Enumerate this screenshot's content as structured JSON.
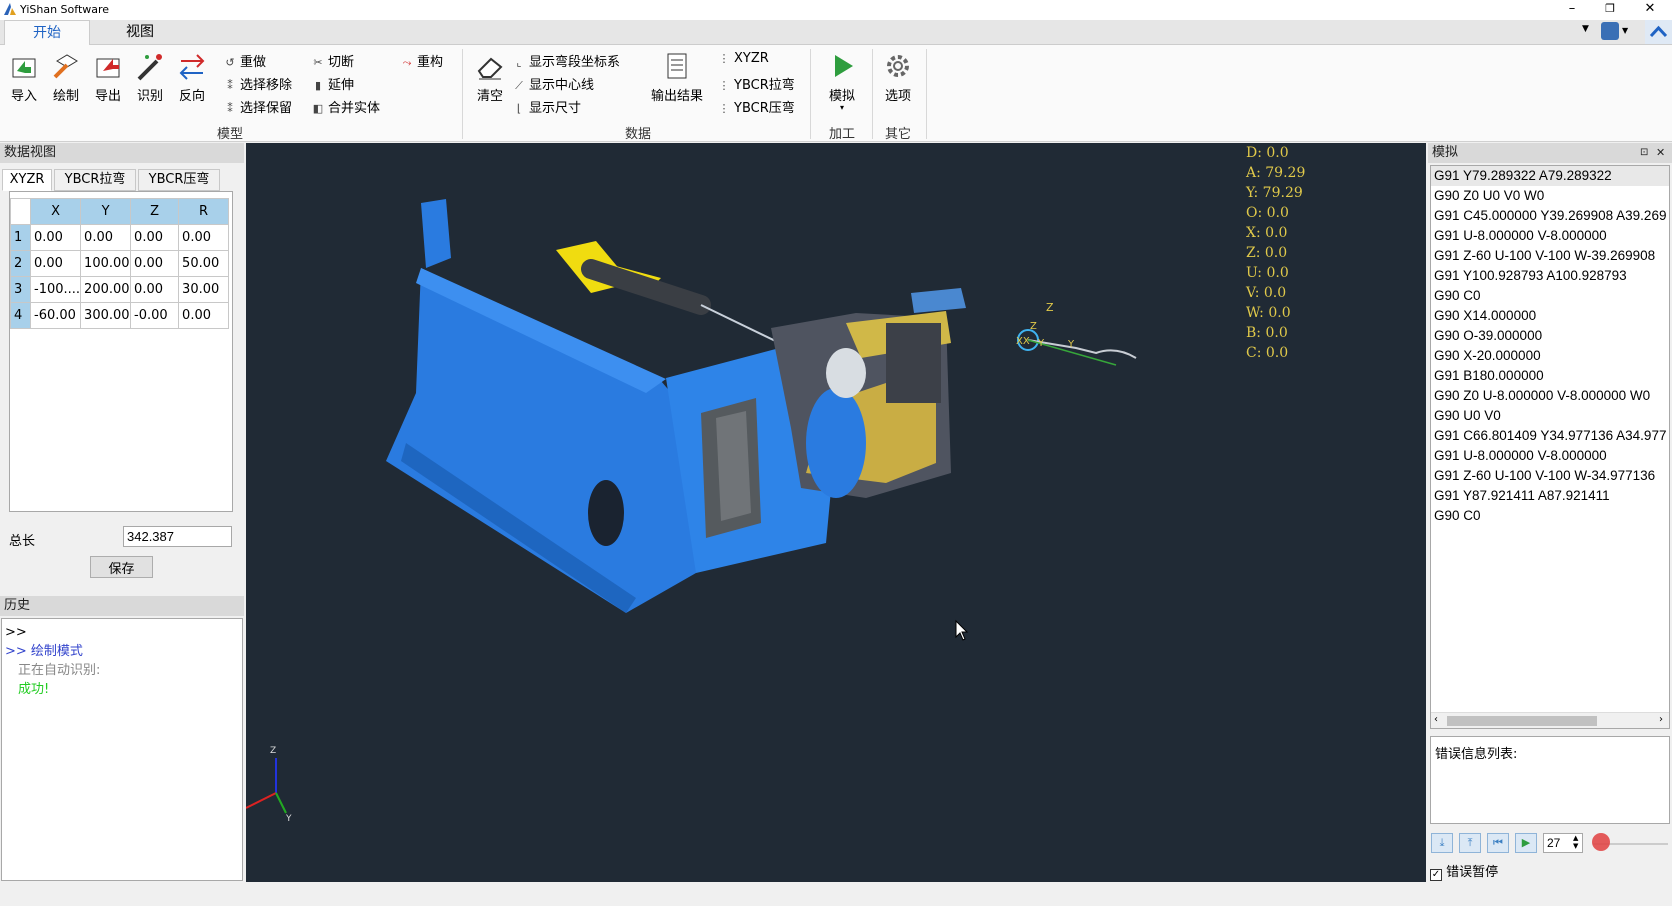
{
  "app": {
    "title": "YiShan Software"
  },
  "window_controls": {
    "minimize": "–",
    "restore": "❐",
    "close": "✕"
  },
  "tabs": [
    {
      "label": "开始",
      "active": true
    },
    {
      "label": "视图",
      "active": false
    }
  ],
  "ribbon": {
    "model_group": {
      "label": "模型",
      "big_buttons": [
        "导入",
        "绘制",
        "导出",
        "识别",
        "反向"
      ],
      "col1": [
        "重做",
        "选择移除",
        "选择保留"
      ],
      "col2": [
        "切断",
        "延伸",
        "合并实体"
      ],
      "col3": [
        "重构"
      ]
    },
    "data_group": {
      "label": "数据",
      "clear": "清空",
      "col1": [
        "显示弯段坐标系",
        "显示中心线",
        "显示尺寸"
      ],
      "output": "输出结果",
      "col2": [
        "XYZR",
        "YBCR拉弯",
        "YBCR压弯"
      ]
    },
    "process_group": {
      "label": "加工",
      "simulate": "模拟"
    },
    "other_group": {
      "label": "其它",
      "options": "选项"
    }
  },
  "data_view": {
    "title": "数据视图",
    "subtabs": [
      "XYZR",
      "YBCR拉弯",
      "YBCR压弯"
    ],
    "columns": [
      "X",
      "Y",
      "Z",
      "R"
    ],
    "rows": [
      {
        "n": "1",
        "cells": [
          "0.00",
          "0.00",
          "0.00",
          "0.00"
        ]
      },
      {
        "n": "2",
        "cells": [
          "0.00",
          "100.00",
          "0.00",
          "50.00"
        ]
      },
      {
        "n": "3",
        "cells": [
          "-100....",
          "200.00",
          "0.00",
          "30.00"
        ]
      },
      {
        "n": "4",
        "cells": [
          "-60.00",
          "300.00",
          "-0.00",
          "0.00"
        ]
      }
    ],
    "total_length_label": "总长",
    "total_length_value": "342.387",
    "save_label": "保存"
  },
  "history": {
    "title": "历史",
    "lines": [
      ">>",
      ">> 绘制模式",
      "正在自动识别:",
      "成功!"
    ]
  },
  "viewport_readout": [
    "D: 0.0",
    "A: 79.29",
    "Y: 79.29",
    "O: 0.0",
    "X: 0.0",
    "Z: 0.0",
    "U: 0.0",
    "V: 0.0",
    "W: 0.0",
    "B: 0.0",
    "C: 0.0"
  ],
  "axis_labels": {
    "z": "Z",
    "x": "X",
    "y": "Y"
  },
  "simulation": {
    "title": "模拟",
    "pin_icon": "⊡",
    "close_icon": "✕",
    "code_lines": [
      "G91 Y79.289322 A79.289322",
      "G90 Z0 U0 V0 W0",
      "G91 C45.000000 Y39.269908 A39.269",
      "G91 U-8.000000 V-8.000000",
      "G91 Z-60 U-100 V-100 W-39.269908",
      "G91 Y100.928793 A100.928793",
      "G90 C0",
      "G90 X14.000000",
      "G90 O-39.000000",
      "G90 X-20.000000",
      "G91 B180.000000",
      "G90 Z0 U-8.000000 V-8.000000 W0",
      "G90 U0 V0",
      "G91 C66.801409 Y34.977136 A34.977",
      "G91 U-8.000000 V-8.000000",
      "G91 Z-60 U-100 V-100 W-34.977136",
      "G91 Y87.921411 A87.921411",
      "G90 C0"
    ],
    "error_list_label": "错误信息列表:",
    "step_value": "27",
    "error_pause_label": "错误暂停",
    "error_pause_checked": true
  }
}
